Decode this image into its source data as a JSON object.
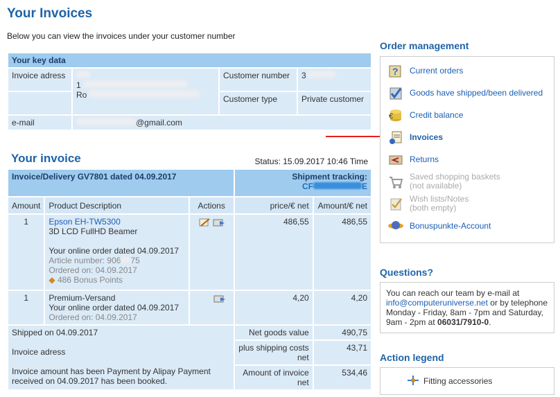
{
  "header": {
    "title": "Your Invoices",
    "intro": "Below you can view the invoices under your customer number"
  },
  "keydata": {
    "title": "Your key data",
    "invoice_address_label": "Invoice adress",
    "invoice_address_prefix_1": "1",
    "invoice_address_prefix_2": "Ro",
    "customer_number_label": "Customer number",
    "customer_number_prefix": "3",
    "customer_type_label": "Customer type",
    "customer_type_value": "Private customer",
    "email_label": "e-mail",
    "email_suffix": "@gmail.com"
  },
  "invoice": {
    "title": "Your invoice",
    "status": "Status: 15.09.2017 10:46 Time",
    "header_left": "Invoice/Delivery GV7801 dated 04.09.2017",
    "shipment_label": "Shipment tracking:",
    "shipment_prefix": "CF",
    "shipment_suffix": "E",
    "cols": {
      "amount": "Amount",
      "product": "Product Description",
      "actions": "Actions",
      "price": "price/€ net",
      "total": "Amount/€ net"
    },
    "rows": [
      {
        "amount": "1",
        "product_link": "Epson EH-TW5300",
        "product_desc": "3D LCD FullHD Beamer",
        "order_note": "Your online order dated 04.09.2017",
        "article": "Article number: 906",
        "article_tail": "75",
        "ordered": "Ordered on: 04.09.2017",
        "bonus": "486 Bonus Points",
        "price": "486,55",
        "total": "486,55"
      },
      {
        "amount": "1",
        "product_name": "Premium-Versand",
        "order_note": "Your online order dated 04.09.2017",
        "ordered": "Ordered on: 04.09.2017",
        "price": "4,20",
        "total": "4,20"
      }
    ],
    "shipped": "Shipped on 04.09.2017",
    "invoice_address": "Invoice adress",
    "payment": "Invoice amount has been Payment by Alipay Payment received on 04.09.2017 has been booked.",
    "net_goods_label": "Net goods value",
    "net_goods_value": "490,75",
    "shipping_label": "plus shipping costs net",
    "shipping_value": "43,71",
    "invoice_amount_label": "Amount of invoice net",
    "invoice_amount_value": "534,46"
  },
  "sidebar": {
    "order_title": "Order management",
    "items": [
      {
        "label": "Current orders",
        "icon": "current-orders-icon"
      },
      {
        "label": "Goods have shipped/been delivered",
        "icon": "delivered-icon"
      },
      {
        "label": "Credit balance",
        "icon": "credit-balance-icon"
      },
      {
        "label": "Invoices",
        "icon": "invoices-icon"
      },
      {
        "label": "Returns",
        "icon": "returns-icon"
      },
      {
        "label": "Saved shopping baskets",
        "sub": "(not available)",
        "icon": "basket-icon"
      },
      {
        "label": "Wish lists/Notes",
        "sub": "(both empty)",
        "icon": "wishlist-icon"
      },
      {
        "label": "Bonuspunkte-Account",
        "icon": "bonus-icon"
      }
    ],
    "questions_title": "Questions?",
    "q_text1": "You can reach our team by e-mail at",
    "q_email": "info@computeruniverse.net",
    "q_text2": "or by telephone Monday - Friday, 8am - 7pm and Saturday, 9am - 2pm at",
    "q_phone": "06031/7910-0",
    "legend_title": "Action legend",
    "legend_item": "Fitting accessories"
  }
}
